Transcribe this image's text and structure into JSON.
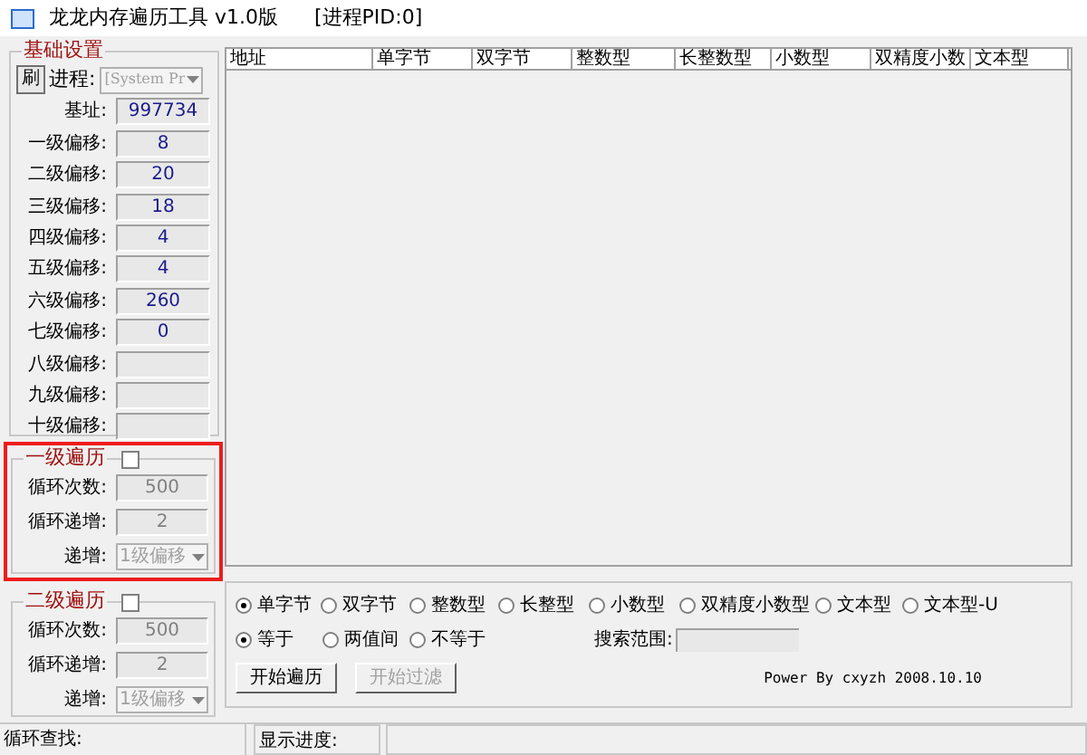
{
  "window": {
    "title": "龙龙内存遍历工具 v1.0版",
    "pid": "[进程PID:0]"
  },
  "basic_settings": {
    "title": "基础设置",
    "refresh_button": "刷",
    "process_label": "进程:",
    "process_value": "[System Pr",
    "process_disabled": true,
    "fields": [
      {
        "label": "基址:",
        "value": "997734"
      },
      {
        "label": "一级偏移:",
        "value": "8"
      },
      {
        "label": "二级偏移:",
        "value": "20"
      },
      {
        "label": "三级偏移:",
        "value": "18"
      },
      {
        "label": "四级偏移:",
        "value": "4"
      },
      {
        "label": "五级偏移:",
        "value": "4"
      },
      {
        "label": "六级偏移:",
        "value": "260"
      },
      {
        "label": "七级偏移:",
        "value": "0"
      },
      {
        "label": "八级偏移:"
      },
      {
        "label": "九级偏移:"
      },
      {
        "label": "十级偏移:"
      }
    ]
  },
  "loops": [
    {
      "title": "一级遍历",
      "checked": false,
      "highlighted": true,
      "count_label": "循环次数:",
      "count": "500",
      "step_label": "循环递增:",
      "step": "2",
      "increment_label": "递增:",
      "increment_value": "1级偏移"
    },
    {
      "title": "二级遍历",
      "checked": false,
      "highlighted": false,
      "count_label": "循环次数:",
      "count": "500",
      "step_label": "循环递增:",
      "step": "2",
      "increment_label": "递增:",
      "increment_value": "1级偏移"
    }
  ],
  "table": {
    "columns": [
      "地址",
      "单字节",
      "双字节",
      "整数型",
      "长整数型",
      "小数型",
      "双精度小数",
      "文本型"
    ]
  },
  "value_types": [
    {
      "label": "单字节",
      "selected": true
    },
    {
      "label": "双字节",
      "selected": false
    },
    {
      "label": "整数型",
      "selected": false
    },
    {
      "label": "长整型",
      "selected": false
    },
    {
      "label": "小数型",
      "selected": false
    },
    {
      "label": "双精度小数型",
      "selected": false
    },
    {
      "label": "文本型",
      "selected": false
    },
    {
      "label": "文本型-U",
      "selected": false
    }
  ],
  "compare_modes": [
    {
      "label": "等于",
      "selected": true
    },
    {
      "label": "两值间",
      "selected": false
    },
    {
      "label": "不等于",
      "selected": false
    }
  ],
  "search_range_label": "搜索范围:",
  "buttons": [
    {
      "label": "开始遍历",
      "disabled": false
    },
    {
      "label": "开始过滤",
      "disabled": true
    }
  ],
  "credit": "Power By cxyzh 2008.10.10",
  "status_bar": {
    "loop_label": "循环查找:",
    "progress_label": "显示进度:",
    "level": 0
  }
}
